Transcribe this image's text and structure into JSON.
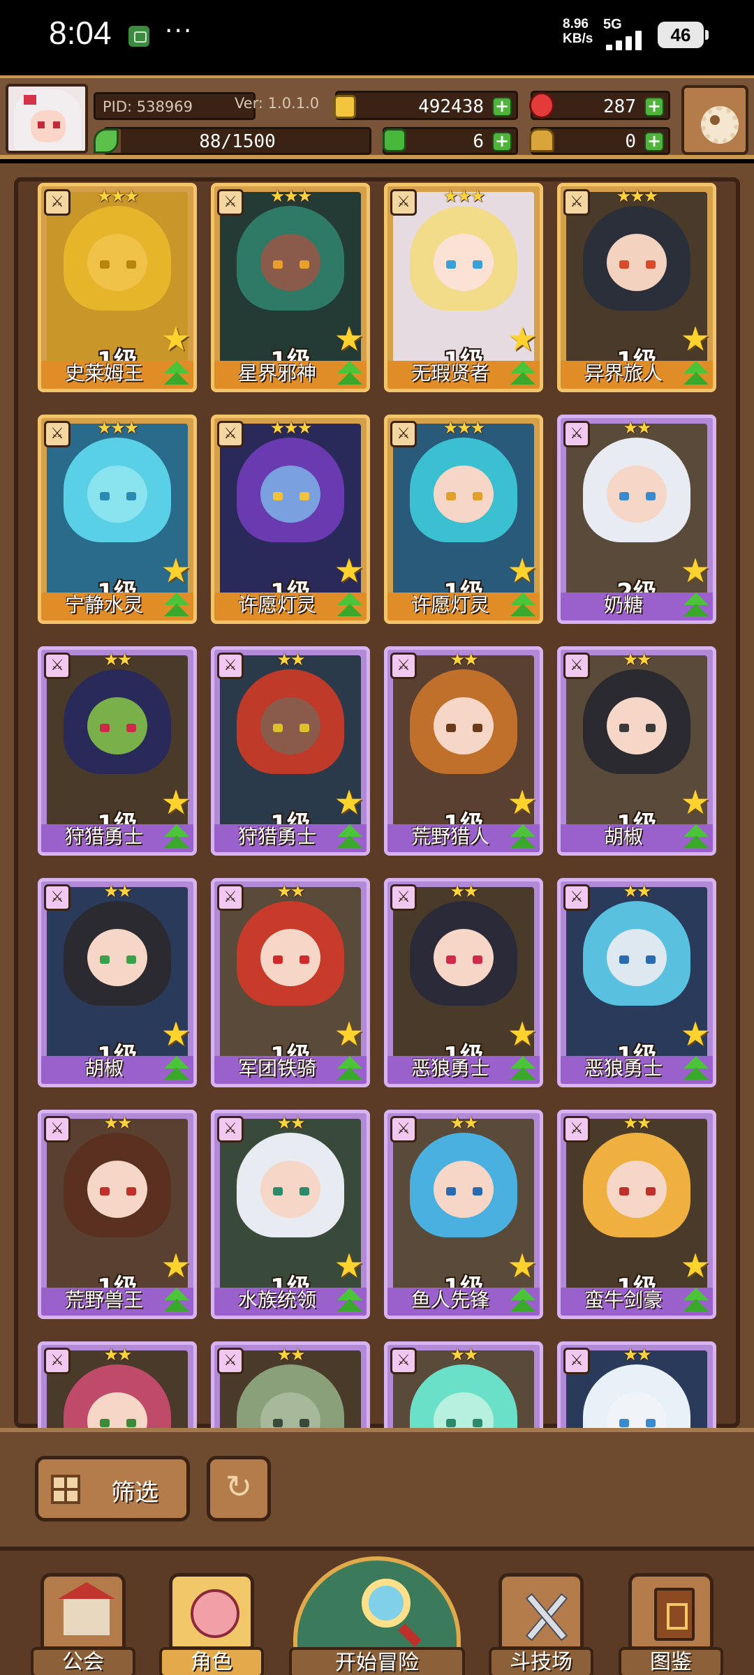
{
  "status_bar": {
    "time": "8:04",
    "net_speed_value": "8.96",
    "net_speed_unit": "KB/s",
    "network": "5G",
    "battery": "46"
  },
  "hud": {
    "pid": "PID: 538969",
    "version": "Ver: 1.0.1.0",
    "gold": "492438",
    "gems": "287",
    "stamina": "88/1500",
    "clover": "6",
    "keys": "0",
    "stamina_fraction": 0.0587
  },
  "cards": [
    {
      "name": "史莱姆王",
      "level": "1级",
      "stars": "★★★",
      "frame": "gold",
      "hair": "#e6b52a",
      "skin": "#f0c248",
      "eye": "#b8860b",
      "bg": "#c9962a"
    },
    {
      "name": "星界邪神",
      "level": "1级",
      "stars": "★★★",
      "frame": "gold",
      "hair": "#2f7a66",
      "skin": "#8a5a4a",
      "eye": "#e8a02a",
      "bg": "#243a34"
    },
    {
      "name": "无瑕贤者",
      "level": "1级",
      "stars": "★★★",
      "frame": "gold",
      "hair": "#f2dc8a",
      "skin": "#fbe2d4",
      "eye": "#3aa0d8",
      "bg": "#e6dbe0"
    },
    {
      "name": "异界旅人",
      "level": "1级",
      "stars": "★★★",
      "frame": "gold",
      "hair": "#2a2f3a",
      "skin": "#f4d2c0",
      "eye": "#d84a2a",
      "bg": "#4a3a2a"
    },
    {
      "name": "宁静水灵",
      "level": "1级",
      "stars": "★★★",
      "frame": "gold",
      "hair": "#5ad0e6",
      "skin": "#8ae4f0",
      "eye": "#2a8ab0",
      "bg": "#2a6a8a"
    },
    {
      "name": "许愿灯灵",
      "level": "1级",
      "stars": "★★★",
      "frame": "gold",
      "hair": "#6a3ab0",
      "skin": "#7aa0e0",
      "eye": "#f2c23a",
      "bg": "#2a2a5a"
    },
    {
      "name": "许愿灯灵",
      "level": "1级",
      "stars": "★★★",
      "frame": "gold",
      "hair": "#3ac0d0",
      "skin": "#f6d6c6",
      "eye": "#e0a02a",
      "bg": "#2a5a7a"
    },
    {
      "name": "奶糖",
      "level": "2级",
      "stars": "★★",
      "frame": "purple",
      "hair": "#e8ecf2",
      "skin": "#f6d6c6",
      "eye": "#3a8ad0",
      "bg": "#5a4a3a"
    },
    {
      "name": "狩猎勇士",
      "level": "1级",
      "stars": "★★",
      "frame": "purple",
      "hair": "#2a2a5a",
      "skin": "#7ab04a",
      "eye": "#d02a4a",
      "bg": "#4a3a2a"
    },
    {
      "name": "狩猎勇士",
      "level": "1级",
      "stars": "★★",
      "frame": "purple",
      "hair": "#c03a2a",
      "skin": "#8a5a4a",
      "eye": "#e0c02a",
      "bg": "#2a3a4a"
    },
    {
      "name": "荒野猎人",
      "level": "1级",
      "stars": "★★",
      "frame": "purple",
      "hair": "#c0702a",
      "skin": "#f6d6c6",
      "eye": "#6a3a1a",
      "bg": "#5a4030"
    },
    {
      "name": "胡椒",
      "level": "1级",
      "stars": "★★",
      "frame": "purple",
      "hair": "#2a2a30",
      "skin": "#f6d6c6",
      "eye": "#3a3a3a",
      "bg": "#5a4a3a"
    },
    {
      "name": "胡椒",
      "level": "1级",
      "stars": "★★",
      "frame": "purple",
      "hair": "#2a2a30",
      "skin": "#f6d6c6",
      "eye": "#3aa04a",
      "bg": "#2a3a5a"
    },
    {
      "name": "军团铁骑",
      "level": "1级",
      "stars": "★★",
      "frame": "purple",
      "hair": "#c83a2a",
      "skin": "#f6d6c6",
      "eye": "#d02a2a",
      "bg": "#5a4a3a"
    },
    {
      "name": "恶狼勇士",
      "level": "1级",
      "stars": "★★",
      "frame": "purple",
      "hair": "#2a2a38",
      "skin": "#f6d6c6",
      "eye": "#d02a4a",
      "bg": "#4a3a2a"
    },
    {
      "name": "恶狼勇士",
      "level": "1级",
      "stars": "★★",
      "frame": "purple",
      "hair": "#5ac0e0",
      "skin": "#dde8f0",
      "eye": "#2a6ab0",
      "bg": "#2a3a5a"
    },
    {
      "name": "荒野兽王",
      "level": "1级",
      "stars": "★★",
      "frame": "purple",
      "hair": "#5a3020",
      "skin": "#f6d6c6",
      "eye": "#c0302a",
      "bg": "#5a4030"
    },
    {
      "name": "水族统领",
      "level": "1级",
      "stars": "★★",
      "frame": "purple",
      "hair": "#e8ecf2",
      "skin": "#f6d6c6",
      "eye": "#2a8a6a",
      "bg": "#3a4a3a"
    },
    {
      "name": "鱼人先锋",
      "level": "1级",
      "stars": "★★",
      "frame": "purple",
      "hair": "#4ab0e0",
      "skin": "#f6d6c6",
      "eye": "#2a6ab0",
      "bg": "#5a4a3a"
    },
    {
      "name": "蛮牛剑豪",
      "level": "1级",
      "stars": "★★",
      "frame": "purple",
      "hair": "#f0b040",
      "skin": "#f6d6c6",
      "eye": "#c0302a",
      "bg": "#4a3a2a"
    },
    {
      "name": "",
      "level": "",
      "stars": "★★",
      "frame": "purple",
      "hair": "#c04a6a",
      "skin": "#f6d6c6",
      "eye": "#3a8a3a",
      "bg": "#4a3a2a"
    },
    {
      "name": "",
      "level": "",
      "stars": "★★",
      "frame": "purple",
      "hair": "#8aa07a",
      "skin": "#a8b89a",
      "eye": "#3a4a3a",
      "bg": "#4a3a2a"
    },
    {
      "name": "",
      "level": "",
      "stars": "★★",
      "frame": "purple",
      "hair": "#6ae0c8",
      "skin": "#b8f0e0",
      "eye": "#2a8a6a",
      "bg": "#5a4a3a"
    },
    {
      "name": "",
      "level": "",
      "stars": "★★",
      "frame": "purple",
      "hair": "#e8f0f8",
      "skin": "#f0f4f8",
      "eye": "#3a8ad0",
      "bg": "#2a3a5a"
    }
  ],
  "filter": {
    "filter_label": "筛选"
  },
  "bottom_nav": {
    "guild": "公会",
    "character": "角色",
    "adventure": "开始冒险",
    "arena": "斗技场",
    "codex": "图鉴"
  }
}
